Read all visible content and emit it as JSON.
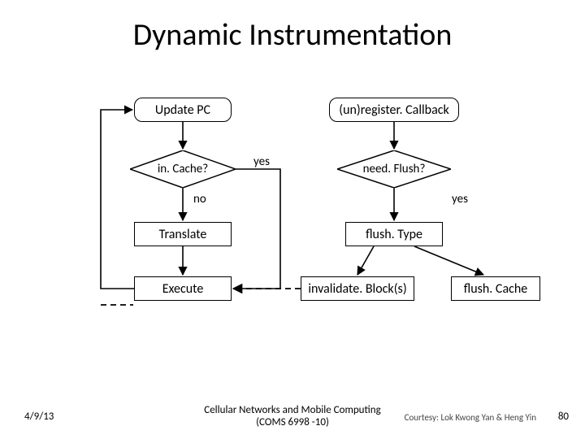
{
  "title": "Dynamic Instrumentation",
  "nodes": {
    "update_pc": "Update PC",
    "in_cache": "in. Cache?",
    "no": "no",
    "translate": "Translate",
    "execute": "Execute",
    "yes_left": "yes",
    "unregister": "(un)register. Callback",
    "need_flush": "need. Flush?",
    "yes_right": "yes",
    "flush_type": "flush. Type",
    "invalidate": "invalidate. Block(s)",
    "flush_cache": "flush. Cache"
  },
  "footer": {
    "date": "4/9/13",
    "center_line1": "Cellular Networks and Mobile Computing",
    "center_line2": "(COMS 6998 -10)",
    "courtesy": "Courtesy: Lok Kwong Yan & Heng Yin",
    "page": "80"
  }
}
